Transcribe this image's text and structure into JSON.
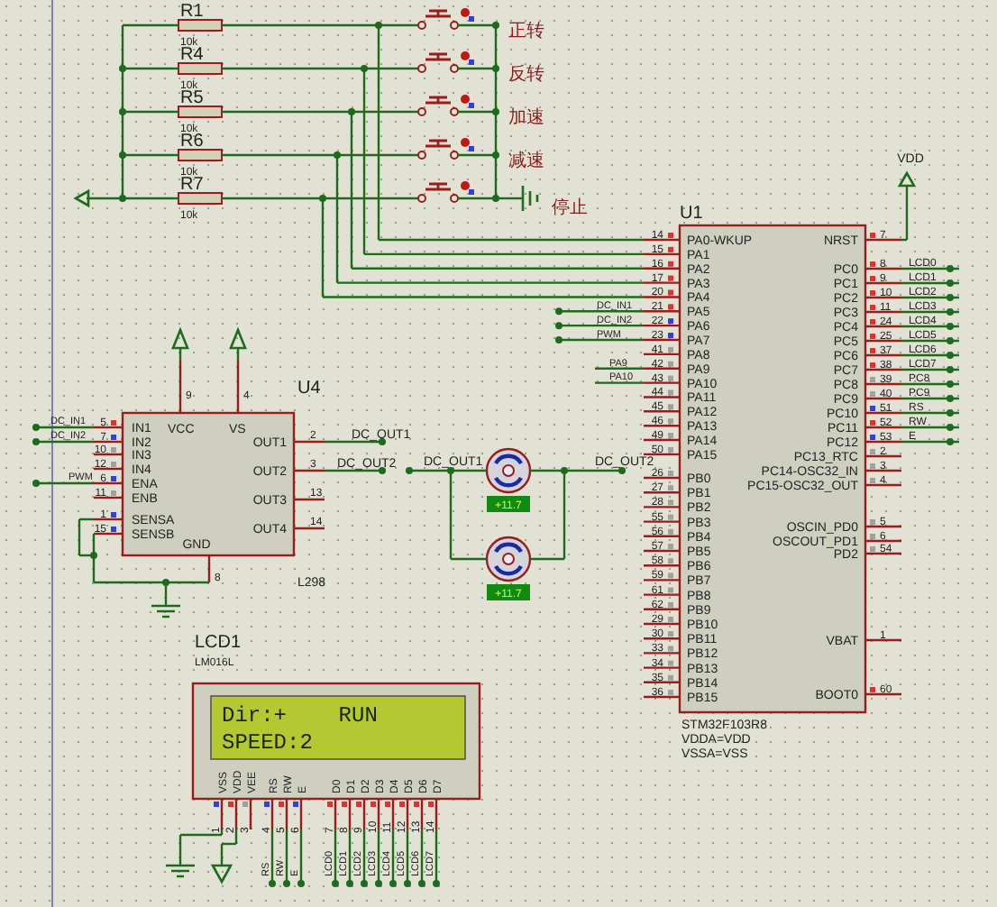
{
  "resistors": [
    {
      "ref": "R1",
      "value": "10k"
    },
    {
      "ref": "R4",
      "value": "10k"
    },
    {
      "ref": "R5",
      "value": "10k"
    },
    {
      "ref": "R6",
      "value": "10k"
    },
    {
      "ref": "R7",
      "value": "10k"
    }
  ],
  "buttons": [
    {
      "label": "正转"
    },
    {
      "label": "反转"
    },
    {
      "label": "加速"
    },
    {
      "label": "减速"
    },
    {
      "label": "停止"
    }
  ],
  "power": {
    "label": "VDD"
  },
  "u1": {
    "ref": "U1",
    "footer": [
      "STM32F103R8",
      "VDDA=VDD",
      "VSSA=VSS"
    ],
    "left_pins": [
      {
        "num": "14",
        "name": "PA0-WKUP",
        "color": "#e03030"
      },
      {
        "num": "15",
        "name": "PA1",
        "color": "#e03030"
      },
      {
        "num": "16",
        "name": "PA2",
        "color": "#e03030"
      },
      {
        "num": "17",
        "name": "PA3",
        "color": "#e03030"
      },
      {
        "num": "20",
        "name": "PA4",
        "color": "#e03030"
      },
      {
        "num": "21",
        "name": "PA5",
        "color": "#e03030",
        "net": "DC_IN1"
      },
      {
        "num": "22",
        "name": "PA6",
        "color": "#3040e0",
        "net": "DC_IN2"
      },
      {
        "num": "23",
        "name": "PA7",
        "color": "#3040e0",
        "net": "PWM"
      },
      {
        "num": "41",
        "name": "PA8",
        "color": "#a0a0a0"
      },
      {
        "num": "42",
        "name": "PA9",
        "color": "#a0a0a0",
        "net": "PA9"
      },
      {
        "num": "43",
        "name": "PA10",
        "color": "#a0a0a0",
        "net": "PA10"
      },
      {
        "num": "44",
        "name": "PA11",
        "color": "#a0a0a0"
      },
      {
        "num": "45",
        "name": "PA12",
        "color": "#a0a0a0"
      },
      {
        "num": "46",
        "name": "PA13",
        "color": "#a0a0a0"
      },
      {
        "num": "49",
        "name": "PA14",
        "color": "#a0a0a0"
      },
      {
        "num": "50",
        "name": "PA15",
        "color": "#a0a0a0"
      },
      {
        "num": "26",
        "name": "PB0",
        "color": "#a0a0a0"
      },
      {
        "num": "27",
        "name": "PB1",
        "color": "#a0a0a0"
      },
      {
        "num": "28",
        "name": "PB2",
        "color": "#a0a0a0"
      },
      {
        "num": "55",
        "name": "PB3",
        "color": "#a0a0a0"
      },
      {
        "num": "56",
        "name": "PB4",
        "color": "#a0a0a0"
      },
      {
        "num": "57",
        "name": "PB5",
        "color": "#a0a0a0"
      },
      {
        "num": "58",
        "name": "PB6",
        "color": "#a0a0a0"
      },
      {
        "num": "59",
        "name": "PB7",
        "color": "#a0a0a0"
      },
      {
        "num": "61",
        "name": "PB8",
        "color": "#a0a0a0"
      },
      {
        "num": "62",
        "name": "PB9",
        "color": "#a0a0a0"
      },
      {
        "num": "29",
        "name": "PB10",
        "color": "#a0a0a0"
      },
      {
        "num": "30",
        "name": "PB11",
        "color": "#a0a0a0"
      },
      {
        "num": "33",
        "name": "PB12",
        "color": "#a0a0a0"
      },
      {
        "num": "34",
        "name": "PB13",
        "color": "#a0a0a0"
      },
      {
        "num": "35",
        "name": "PB14",
        "color": "#a0a0a0"
      },
      {
        "num": "36",
        "name": "PB15",
        "color": "#a0a0a0"
      }
    ],
    "right_pins": [
      {
        "num": "7",
        "name": "NRST",
        "color": "#e03030"
      },
      {
        "num": "8",
        "name": "PC0",
        "color": "#e03030",
        "net": "LCD0"
      },
      {
        "num": "9",
        "name": "PC1",
        "color": "#e03030",
        "net": "LCD1"
      },
      {
        "num": "10",
        "name": "PC2",
        "color": "#e03030",
        "net": "LCD2"
      },
      {
        "num": "11",
        "name": "PC3",
        "color": "#e03030",
        "net": "LCD3"
      },
      {
        "num": "24",
        "name": "PC4",
        "color": "#e03030",
        "net": "LCD4"
      },
      {
        "num": "25",
        "name": "PC5",
        "color": "#e03030",
        "net": "LCD5"
      },
      {
        "num": "37",
        "name": "PC6",
        "color": "#e03030",
        "net": "LCD6"
      },
      {
        "num": "38",
        "name": "PC7",
        "color": "#e03030",
        "net": "LCD7"
      },
      {
        "num": "39",
        "name": "PC8",
        "color": "#a0a0a0",
        "net": "PC8"
      },
      {
        "num": "40",
        "name": "PC9",
        "color": "#a0a0a0",
        "net": "PC9"
      },
      {
        "num": "51",
        "name": "PC10",
        "color": "#3040e0",
        "net": "RS"
      },
      {
        "num": "52",
        "name": "PC11",
        "color": "#e03030",
        "net": "RW"
      },
      {
        "num": "53",
        "name": "PC12",
        "color": "#3040e0",
        "net": "E"
      },
      {
        "num": "2",
        "name": "PC13_RTC",
        "color": "#a0a0a0"
      },
      {
        "num": "3",
        "name": "PC14-OSC32_IN",
        "color": "#a0a0a0"
      },
      {
        "num": "4",
        "name": "PC15-OSC32_OUT",
        "color": "#a0a0a0"
      },
      {
        "num": "5",
        "name": "OSCIN_PD0",
        "color": "#a0a0a0"
      },
      {
        "num": "6",
        "name": "OSCOUT_PD1",
        "color": "#a0a0a0"
      },
      {
        "num": "54",
        "name": "PD2",
        "color": "#a0a0a0"
      },
      {
        "num": "1",
        "name": "VBAT"
      },
      {
        "num": "60",
        "name": "BOOT0",
        "color": "#e03030"
      }
    ]
  },
  "u4": {
    "ref": "U4",
    "part": "L298",
    "left_pins": [
      {
        "num": "5",
        "name": "IN1",
        "color": "#e03030",
        "net": "DC_IN1"
      },
      {
        "num": "7",
        "name": "IN2",
        "color": "#3040e0",
        "net": "DC_IN2"
      },
      {
        "num": "10",
        "name": "IN3",
        "color": "#a0a0a0"
      },
      {
        "num": "12",
        "name": "IN4",
        "color": "#a0a0a0"
      },
      {
        "num": "6",
        "name": "ENA",
        "color": "#3040e0",
        "net": "PWM"
      },
      {
        "num": "11",
        "name": "ENB",
        "color": "#a0a0a0"
      },
      {
        "num": "1",
        "name": "SENSA",
        "color": "#3040e0"
      },
      {
        "num": "15",
        "name": "SENSB",
        "color": "#3040e0"
      }
    ],
    "top_pins": [
      {
        "num": "9",
        "name": "VCC"
      },
      {
        "num": "4",
        "name": "VS"
      }
    ],
    "right_pins": [
      {
        "num": "2",
        "name": "OUT1",
        "net": "DC_OUT1"
      },
      {
        "num": "3",
        "name": "OUT2",
        "net": "DC_OUT2"
      },
      {
        "num": "13",
        "name": "OUT3"
      },
      {
        "num": "14",
        "name": "OUT4"
      }
    ],
    "bottom_pins": [
      {
        "num": "8",
        "name": "GND"
      }
    ]
  },
  "motor_nets": [
    "DC_OUT1",
    "DC_OUT2"
  ],
  "motors": [
    {
      "reading": "+11.7"
    },
    {
      "reading": "+11.7"
    }
  ],
  "lcd": {
    "ref": "LCD1",
    "part": "LM016L",
    "lines": [
      "Dir:+    RUN",
      "SPEED:2"
    ],
    "pins": [
      {
        "num": "1",
        "name": "VSS",
        "color": "#3040e0"
      },
      {
        "num": "2",
        "name": "VDD",
        "color": "#e03030"
      },
      {
        "num": "3",
        "name": "VEE",
        "color": "#a0a0a0"
      },
      {
        "num": "4",
        "name": "RS",
        "color": "#3040e0",
        "net": "RS"
      },
      {
        "num": "5",
        "name": "RW",
        "color": "#e03030",
        "net": "RW"
      },
      {
        "num": "6",
        "name": "E",
        "color": "#3040e0",
        "net": "E"
      },
      {
        "num": "7",
        "name": "D0",
        "color": "#e03030",
        "net": "LCD0"
      },
      {
        "num": "8",
        "name": "D1",
        "color": "#e03030",
        "net": "LCD1"
      },
      {
        "num": "9",
        "name": "D2",
        "color": "#e03030",
        "net": "LCD2"
      },
      {
        "num": "10",
        "name": "D3",
        "color": "#e03030",
        "net": "LCD3"
      },
      {
        "num": "11",
        "name": "D4",
        "color": "#e03030",
        "net": "LCD4"
      },
      {
        "num": "12",
        "name": "D5",
        "color": "#e03030",
        "net": "LCD5"
      },
      {
        "num": "13",
        "name": "D6",
        "color": "#e03030",
        "net": "LCD6"
      },
      {
        "num": "14",
        "name": "D7",
        "color": "#e03030",
        "net": "LCD7"
      }
    ]
  }
}
